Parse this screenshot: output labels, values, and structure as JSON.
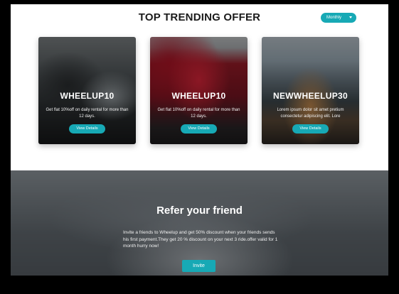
{
  "offers": {
    "title": "TOP TRENDING OFFER",
    "filter": {
      "selected": "Monthly"
    },
    "cards": [
      {
        "code": "WHEELUP10",
        "description": "Get flat 10%off on daily rental for more than 12 days.",
        "button": "View Details"
      },
      {
        "code": "WHEELUP10",
        "description": "Get flat 10%off on daily rental for more than 12 days.",
        "button": "View Details"
      },
      {
        "code": "NEWWHEELUP30",
        "description": "Lorem ipsum dolor sit amet pretium consectetur adipiscing elit. Lore",
        "button": "View Details"
      }
    ]
  },
  "refer": {
    "title": "Refer your friend",
    "text": "Invite a friends to Wheelup and get 50% discount when your friends sends his first payment.They get 20 % discount on your next 3 ride.offer valid for 1 month hurry now!",
    "button": "Invite"
  },
  "colors": {
    "accent": "#17a9b5"
  }
}
